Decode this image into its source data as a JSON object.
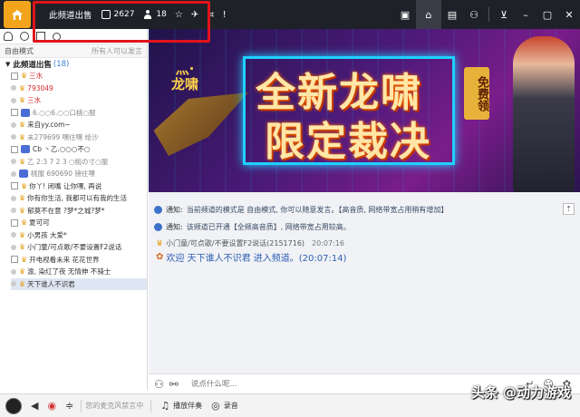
{
  "titlebar": {
    "room_name": "此频道出售",
    "room_id": "2627",
    "online_count": "18",
    "star": "☆",
    "plane": "✈",
    "share": "⋖",
    "info": "!"
  },
  "window_controls": {
    "video": "▣",
    "home": "⌂",
    "list": "▤",
    "game": "⚇",
    "minimize_tray": "⊻",
    "minimize": "–",
    "maximize": "▢",
    "close": "✕"
  },
  "left": {
    "mode_label": "自由模式",
    "mode_right": "所有人可以发言",
    "channel_name": "此频道出售",
    "channel_count": "(18)",
    "users": [
      {
        "name": "三水",
        "style": "red",
        "badge": "crown"
      },
      {
        "name": "793049",
        "style": "red",
        "badge": "crown"
      },
      {
        "name": "三水",
        "style": "red",
        "badge": "crown"
      },
      {
        "name": "6.○○6.○○口桃○服",
        "style": "gray",
        "badge": "blue"
      },
      {
        "name": "来自yy.com~",
        "style": "",
        "badge": "crown"
      },
      {
        "name": "未279699 嘿往嘿 给沙",
        "style": "gray",
        "badge": "crown"
      },
      {
        "name": "Cb 丶乙.○○○不○",
        "style": "",
        "badge": "blue"
      },
      {
        "name": "乙 2:3 7 2 3 ○桃の寸○服",
        "style": "gray",
        "badge": "crown"
      },
      {
        "name": "桃服  690690  镑往嘿",
        "style": "gray",
        "badge": "blue"
      },
      {
        "name": "你丫! 闭嘴  让你嘿, 再说",
        "style": "",
        "badge": "crown"
      },
      {
        "name": "你有你生活, 我都可以有我的生活",
        "style": "",
        "badge": "crown"
      },
      {
        "name": "郁莫不在意  ?梦*之城?梦*",
        "style": "",
        "badge": "crown"
      },
      {
        "name": "夏可可",
        "style": "",
        "badge": "crown"
      },
      {
        "name": "小男孩  大爱*",
        "style": "",
        "badge": "crown"
      },
      {
        "name": "小门童/可点歌/不要设置F2说话",
        "style": "",
        "badge": "crown"
      },
      {
        "name": "开电视看未来  花花世界",
        "style": "",
        "badge": "crown"
      },
      {
        "name": "渝, 染红了夜  无情伸  不骑士",
        "style": "",
        "badge": "crown"
      },
      {
        "name": "天下谁人不识君",
        "style": "",
        "badge": "crown"
      }
    ]
  },
  "banner": {
    "game_tag": "灬·龙啸",
    "title_line1": "全新龙啸",
    "title_line2": "限定裁决",
    "free_tag": "免费领"
  },
  "notices": [
    {
      "label": "通知:",
      "text": "当前频道的模式是 自由模式, 你可以随意发言。【高音质, 网络带宽占用稍有增加】"
    },
    {
      "label": "通知:",
      "text": "该频道已开通【全频高音质】, 网络带宽占用较高。"
    }
  ],
  "message": {
    "sender": "小门童/可点歌/不要设置F2说话(2151716)",
    "time": "20:07:16",
    "body": "欢迎  天下谁人不识君  进入频道。(20:07:14)"
  },
  "input": {
    "placeholder": "说点什么呢..."
  },
  "bottombar": {
    "mic_status": "您的麦克风禁言中",
    "play_music": "播放伴奏",
    "record": "录音"
  },
  "watermark": "头条 @动力游戏",
  "colors": {
    "titlebar_bg": "#1f2128",
    "highlight_frame": "#e0141b",
    "accent_blue": "#2f5fb3",
    "logo_orange": "#f2a51c"
  }
}
